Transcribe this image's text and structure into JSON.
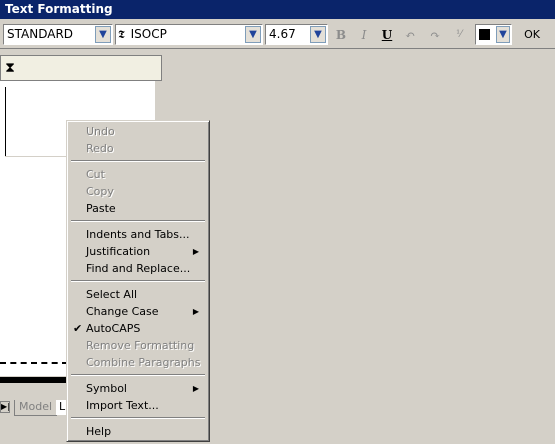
{
  "window": {
    "title": "Text Formatting"
  },
  "toolbar": {
    "style_value": "STANDARD",
    "font_icon": "truetype-font-icon",
    "font_value": "ISOCP",
    "height_value": "4.67",
    "bold_label": "B",
    "italic_label": "I",
    "underline_label": "U",
    "undo_icon": "undo-icon",
    "redo_icon": "redo-icon",
    "stack_icon": "stack-fraction-icon",
    "color_swatch": "#000000",
    "ok_label": "OK"
  },
  "ruler": {
    "tab_icon": "ruler-tab-icon"
  },
  "tabs": {
    "model_label": "Model",
    "layout_label": "L"
  },
  "context_menu": {
    "items": [
      {
        "label": "Undo",
        "enabled": false
      },
      {
        "label": "Redo",
        "enabled": false
      },
      {
        "label": "Cut",
        "enabled": false
      },
      {
        "label": "Copy",
        "enabled": false
      },
      {
        "label": "Paste",
        "enabled": true
      },
      {
        "label": "Indents and Tabs...",
        "enabled": true
      },
      {
        "label": "Justification",
        "enabled": true,
        "submenu": true
      },
      {
        "label": "Find and Replace...",
        "enabled": true
      },
      {
        "label": "Select All",
        "enabled": true
      },
      {
        "label": "Change Case",
        "enabled": true,
        "submenu": true
      },
      {
        "label": "AutoCAPS",
        "enabled": true,
        "checked": true
      },
      {
        "label": "Remove Formatting",
        "enabled": false
      },
      {
        "label": "Combine Paragraphs",
        "enabled": false
      },
      {
        "label": "Symbol",
        "enabled": true,
        "submenu": true
      },
      {
        "label": "Import Text...",
        "enabled": true
      },
      {
        "label": "Help",
        "enabled": true
      }
    ]
  }
}
